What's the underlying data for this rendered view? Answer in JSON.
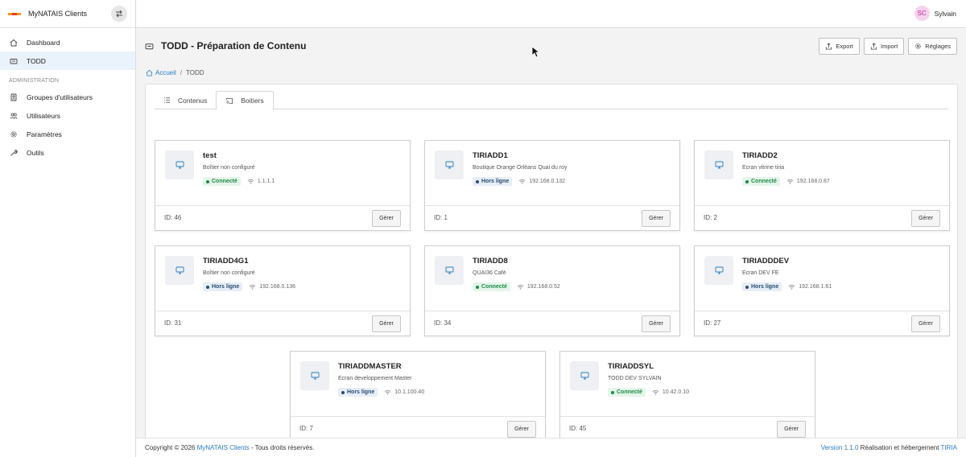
{
  "app": {
    "name": "MyNATAIS Clients"
  },
  "sidebar": {
    "items": [
      {
        "label": "Dashboard",
        "icon": "home-icon",
        "active": false
      },
      {
        "label": "TODD",
        "icon": "device-icon",
        "active": true
      }
    ],
    "section_label": "ADMINISTRATION",
    "admin_items": [
      {
        "label": "Groupes d'utilisateurs",
        "icon": "group-icon"
      },
      {
        "label": "Utilisateurs",
        "icon": "users-icon"
      },
      {
        "label": "Paramètres",
        "icon": "gear-icon"
      },
      {
        "label": "Outils",
        "icon": "wrench-icon"
      }
    ]
  },
  "user": {
    "initials": "SC",
    "name": "Sylvain"
  },
  "page": {
    "title": "TODD - Préparation de Contenu",
    "actions": [
      {
        "label": "Export",
        "icon": "export-icon"
      },
      {
        "label": "Import",
        "icon": "import-icon"
      },
      {
        "label": "Réglages",
        "icon": "gear-icon"
      }
    ],
    "breadcrumb": {
      "home": "Accueil",
      "separator": "/",
      "current": "TODD"
    },
    "tabs": [
      {
        "label": "Contenus",
        "icon": "list-icon",
        "active": false
      },
      {
        "label": "Boitiers",
        "icon": "cast-icon",
        "active": true
      }
    ]
  },
  "devices": [
    {
      "name": "test",
      "desc": "Boîtier non configuré",
      "status": "Connecté",
      "online": true,
      "ip": "1.1.1.1",
      "id_label": "ID: 46",
      "button": "Gérer"
    },
    {
      "name": "TIRIADD1",
      "desc": "Boutique Orange Orléans Quai du roy",
      "status": "Hors ligne",
      "online": false,
      "ip": "192.168.0.132",
      "id_label": "ID: 1",
      "button": "Gérer"
    },
    {
      "name": "TIRIADD2",
      "desc": "Ecran vitrine tiria",
      "status": "Connecté",
      "online": true,
      "ip": "192.168.0.87",
      "id_label": "ID: 2",
      "button": "Gérer"
    },
    {
      "name": "TIRIADD4G1",
      "desc": "Boîtier non configuré",
      "status": "Hors ligne",
      "online": false,
      "ip": "192.168.0.136",
      "id_label": "ID: 31",
      "button": "Gérer"
    },
    {
      "name": "TIRIADD8",
      "desc": "QUAI36 Café",
      "status": "Connecté",
      "online": true,
      "ip": "192.168.0.52",
      "id_label": "ID: 34",
      "button": "Gérer"
    },
    {
      "name": "TIRIADDDEV",
      "desc": "Ecran DEV FE",
      "status": "Hors ligne",
      "online": false,
      "ip": "192.168.1.61",
      "id_label": "ID: 27",
      "button": "Gérer"
    },
    {
      "name": "TIRIADDMASTER",
      "desc": "Ecran developpement Master",
      "status": "Hors ligne",
      "online": false,
      "ip": "10.1.100.40",
      "id_label": "ID: 7",
      "button": "Gérer"
    },
    {
      "name": "TIRIADDSYL",
      "desc": "TODD DEV SYLVAIN",
      "status": "Connecté",
      "online": true,
      "ip": "10.42.0.10",
      "id_label": "ID: 45",
      "button": "Gérer"
    }
  ],
  "footer": {
    "copyright_prefix": "Copyright © 2026",
    "copyright_link": "MyNATAIS Clients",
    "copyright_suffix": "- Tous droits réservés.",
    "version": "Version 1.1.0",
    "hosting_text": "Réalisation et hébergement",
    "hosting_link": "TIRIA"
  },
  "colors": {
    "link": "#2b7bbf",
    "active_nav_bg": "#eaf2fb",
    "online_green": "#1e8a46",
    "offline_blue": "#2a4d72",
    "avatar_bg": "#f6d3ec",
    "avatar_text": "#c0289b"
  }
}
